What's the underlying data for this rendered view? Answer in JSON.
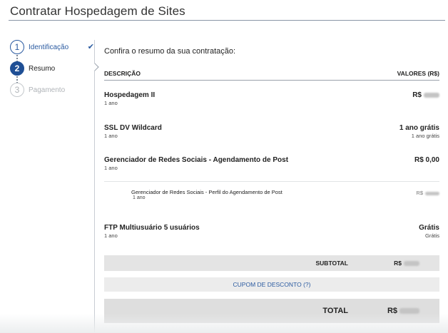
{
  "header": {
    "title": "Contratar Hospedagem de Sites"
  },
  "stepper": {
    "steps": [
      {
        "number": "1",
        "label": "Identificação",
        "state": "done",
        "check_icon": "checkmark-icon"
      },
      {
        "number": "2",
        "label": "Resumo",
        "state": "active"
      },
      {
        "number": "3",
        "label": "Pagamento",
        "state": "pending"
      }
    ]
  },
  "summary": {
    "intro": "Confira o resumo da sua contratação:",
    "col_description": "DESCRIÇÃO",
    "col_values": "VALORES (R$)",
    "items": [
      {
        "name": "Hospedagem II",
        "period": "1 ano",
        "value": "R$",
        "value_blurred": true
      },
      {
        "name": "SSL DV Wildcard",
        "period": "1 ano",
        "value": "1 ano grátis",
        "value_sub": "1 ano grátis"
      },
      {
        "name": "Gerenciador de Redes Sociais - Agendamento de Post",
        "period": "1 ano",
        "value": "R$ 0,00"
      },
      {
        "name": "FTP Multiusuário 5 usuários",
        "period": "1 ano",
        "value": "Grátis",
        "value_sub": "Grátis"
      }
    ],
    "sub_item": {
      "name": "Gerenciador de Redes Sociais - Perfil do Agendamento de Post",
      "period": "1 ano",
      "value": "R$",
      "value_blurred": true
    },
    "subtotal_label": "SUBTOTAL",
    "subtotal_value": "R$",
    "coupon_label": "CUPOM DE DESCONTO (?)",
    "total_label": "TOTAL",
    "total_value": "R$"
  },
  "colors": {
    "accent": "#1f4f95",
    "link": "#2a5aa0",
    "bar_bg": "#e4e4e4"
  }
}
